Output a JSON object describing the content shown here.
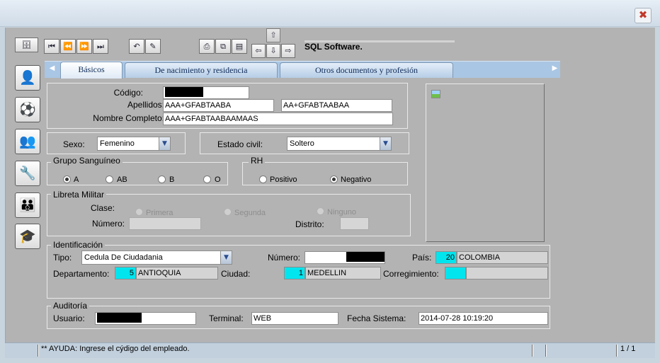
{
  "window": {
    "close_glyph": "✖"
  },
  "toolbar": {
    "buttons": [
      {
        "name": "database-icon",
        "glyph": "🗄"
      },
      {
        "name": "first-record-icon",
        "glyph": "⏮"
      },
      {
        "name": "previous-record-icon",
        "glyph": "⏪"
      },
      {
        "name": "next-record-icon",
        "glyph": "⏩"
      },
      {
        "name": "last-record-icon",
        "glyph": "⏭"
      },
      {
        "name": "undo-icon",
        "glyph": "↶"
      },
      {
        "name": "edit-icon",
        "glyph": "✎"
      },
      {
        "name": "print-icon",
        "glyph": "⎙"
      },
      {
        "name": "copy-icon",
        "glyph": "⧉"
      },
      {
        "name": "report-icon",
        "glyph": "▤"
      },
      {
        "name": "arrow-up-icon",
        "glyph": "⇧"
      },
      {
        "name": "arrow-left-icon",
        "glyph": "⇦"
      },
      {
        "name": "arrow-down-icon",
        "glyph": "⇩"
      },
      {
        "name": "arrow-right-icon",
        "glyph": "⇨"
      }
    ],
    "app_label": "SQL Software."
  },
  "sidebar": [
    {
      "name": "employee-icon",
      "glyph": "👤"
    },
    {
      "name": "soccer-ball-icon",
      "glyph": "⚽"
    },
    {
      "name": "people-icon",
      "glyph": "👥"
    },
    {
      "name": "tools-icon",
      "glyph": "🔧"
    },
    {
      "name": "group-icon",
      "glyph": "👪"
    },
    {
      "name": "teacher-icon",
      "glyph": "🎓"
    }
  ],
  "tabs": {
    "basicos": "Básicos",
    "nacimiento": "De nacimiento y residencia",
    "otros": "Otros documentos y profesión",
    "scroll_left": "◀",
    "scroll_right": "▶"
  },
  "basic": {
    "codigo_label": "Código:",
    "apellidos_label": "Apellidos:",
    "apellido1": "AAA+GFABTAABA",
    "apellido2": "AA+GFABTAABAA",
    "nombre_label": "Nombre Completo:",
    "nombre": "AAA+GFABTAABAAMAAS"
  },
  "sexo": {
    "label": "Sexo:",
    "value": "Femenino"
  },
  "estado_civil": {
    "label": "Estado civil:",
    "value": "Soltero"
  },
  "combo_arrow": "▼",
  "grupo_sanguineo": {
    "title": "Grupo Sanguíneo",
    "options": [
      "A",
      "AB",
      "B",
      "O"
    ],
    "selected": "A"
  },
  "rh": {
    "title": "RH",
    "options": [
      "Positivo",
      "Negativo"
    ],
    "selected": "Negativo"
  },
  "libreta": {
    "title": "Libreta Militar",
    "clase_label": "Clase:",
    "clases": [
      "Primera",
      "Segunda",
      "Ninguno"
    ],
    "numero_label": "Número:",
    "distrito_label": "Distrito:"
  },
  "identificacion": {
    "title": "Identificación",
    "tipo_label": "Tipo:",
    "tipo_value": "Cedula De Ciudadania",
    "numero_label": "Número:",
    "pais_label": "País:",
    "pais_code": "20",
    "pais_name": "COLOMBIA",
    "depto_label": "Departamento:",
    "depto_code": "5",
    "depto_name": "ANTIOQUIA",
    "ciudad_label": "Ciudad:",
    "ciudad_code": "1",
    "ciudad_name": "MEDELLIN",
    "corregimiento_label": "Corregimiento:"
  },
  "auditoria": {
    "title": "Auditoría",
    "usuario_label": "Usuario:",
    "terminal_label": "Terminal:",
    "terminal_value": "WEB",
    "fecha_label": "Fecha Sistema:",
    "fecha_value": "2014-07-28 10:19:20"
  },
  "status": {
    "help": "** AYUDA: Ingrese el cýdigo del empleado.",
    "page": "1 / 1"
  },
  "colors": {
    "client_bg": "#b3b3b3",
    "tab_strip": "#a9c6e4",
    "lookup_code": "#00e5ee",
    "title_bar": "#dce6f0"
  }
}
